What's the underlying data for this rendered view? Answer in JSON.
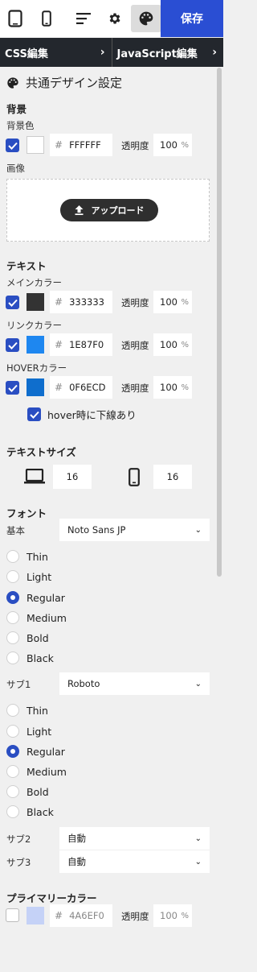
{
  "toolbar": {
    "icons": [
      "tablet-icon",
      "phone-icon",
      "text-align-icon",
      "gear-icon",
      "palette-icon"
    ],
    "save_label": "保存"
  },
  "tabs": [
    {
      "label": "CSS編集"
    },
    {
      "label": "JavaScript編集"
    }
  ],
  "panel": {
    "title": "共通デザイン設定",
    "background": {
      "heading": "背景",
      "color_label": "背景色",
      "checked": true,
      "swatch": "#FFFFFF",
      "hex": "FFFFFF",
      "alpha_label": "透明度",
      "alpha": "100",
      "pct": "%",
      "image_label": "画像",
      "upload_label": "アップロード"
    },
    "text": {
      "heading": "テキスト",
      "rows": [
        {
          "label": "メインカラー",
          "hex": "333333",
          "swatch": "#333333",
          "alpha": "100",
          "checked": true
        },
        {
          "label": "リンクカラー",
          "hex": "1E87F0",
          "swatch": "#1E87F0",
          "alpha": "100",
          "checked": true
        },
        {
          "label": "HOVERカラー",
          "hex": "0F6ECD",
          "swatch": "#0F6ECD",
          "alpha": "100",
          "checked": true
        }
      ],
      "alpha_label": "透明度",
      "pct": "%",
      "hover_underline": "hover時に下線あり"
    },
    "text_size": {
      "heading": "テキストサイズ",
      "desktop": "16",
      "mobile": "16"
    },
    "font": {
      "heading": "フォント",
      "base_label": "基本",
      "base_value": "Noto Sans JP",
      "sub1_label": "サブ1",
      "sub1_value": "Roboto",
      "sub2_label": "サブ2",
      "sub2_value": "自動",
      "sub3_label": "サブ3",
      "sub3_value": "自動",
      "weights": [
        "Thin",
        "Light",
        "Regular",
        "Medium",
        "Bold",
        "Black"
      ],
      "base_selected": "Regular",
      "sub1_selected": "Regular"
    },
    "primary": {
      "heading": "プライマリーカラー",
      "checked": false,
      "swatch": "#C5D2F7",
      "hex": "4A6EF0",
      "alpha_label": "透明度",
      "alpha": "100",
      "pct": "%"
    }
  }
}
